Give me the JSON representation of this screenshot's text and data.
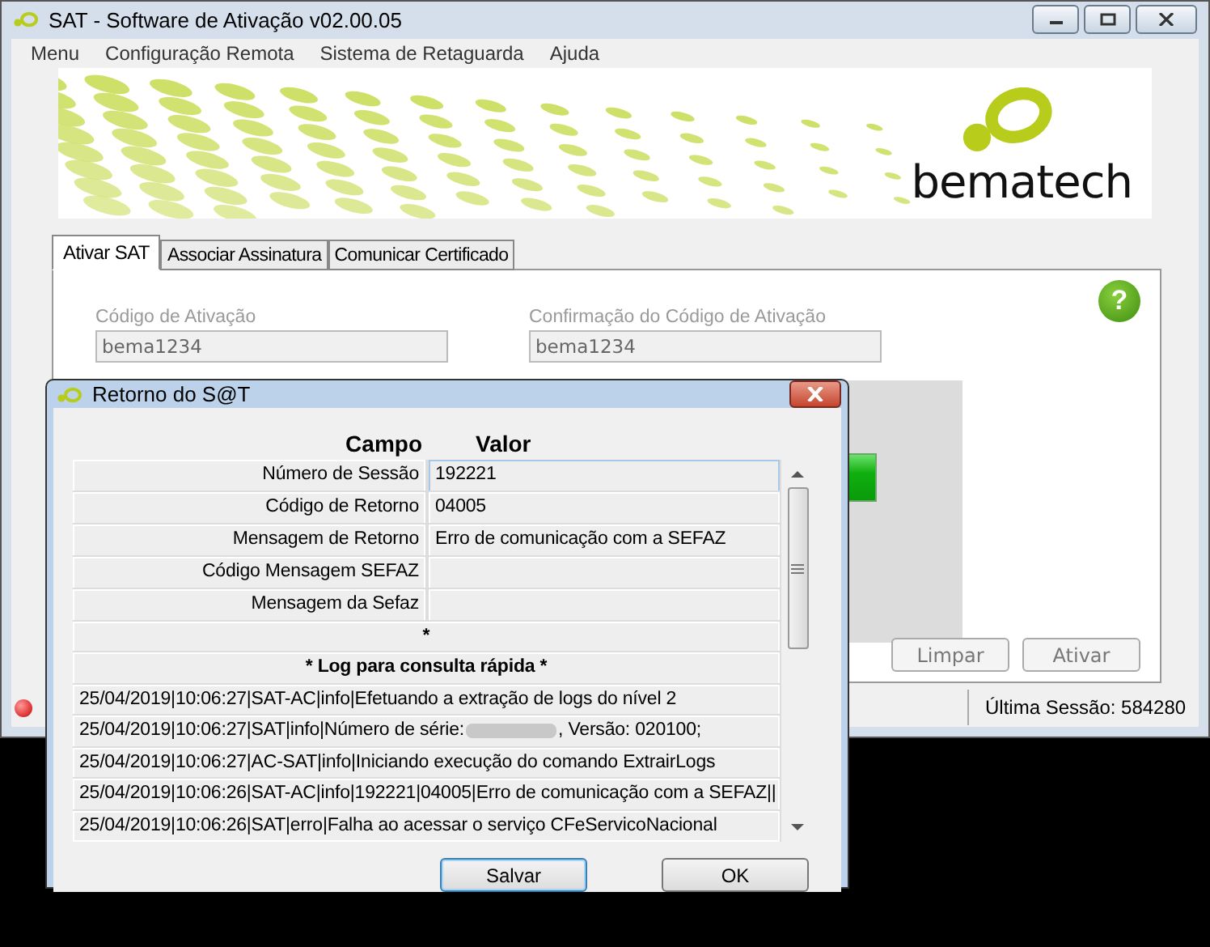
{
  "window": {
    "title": "SAT - Software de Ativação v02.00.05"
  },
  "menu": [
    "Menu",
    "Configuração Remota",
    "Sistema de Retaguarda",
    "Ajuda"
  ],
  "banner": {
    "brand": "bematech"
  },
  "tabs": [
    {
      "label": "Ativar SAT",
      "selected": true
    },
    {
      "label": "Associar Assinatura",
      "selected": false
    },
    {
      "label": "Comunicar Certificado",
      "selected": false
    }
  ],
  "help": "?",
  "fields": [
    {
      "label": "Código de Ativação",
      "value": "bema1234",
      "disabled": true
    },
    {
      "label": "Confirmação do Código de Ativação",
      "value": "bema1234",
      "disabled": true
    }
  ],
  "buttons": [
    {
      "label": "Limpar",
      "disabled": true
    },
    {
      "label": "Ativar",
      "disabled": true
    }
  ],
  "status_bar": {
    "connected": false,
    "last_session": "Última Sessão: 584280"
  },
  "dialog": {
    "title": "Retorno do S@T",
    "columns": [
      "Campo",
      "Valor"
    ],
    "rows": [
      {
        "field": "Número de Sessão",
        "value": "192221",
        "selected": true
      },
      {
        "field": "Código de Retorno",
        "value": "04005",
        "selected": false
      },
      {
        "field": "Mensagem de Retorno",
        "value": "Erro de comunicação com a SEFAZ",
        "selected": false
      },
      {
        "field": "Código Mensagem SEFAZ",
        "value": "",
        "selected": false
      },
      {
        "field": "Mensagem da Sefaz",
        "value": "",
        "selected": false
      }
    ],
    "separator": "*",
    "log_title": "* Log para consulta rápida *",
    "log": [
      {
        "kind": "plain",
        "text": "25/04/2019|10:06:27|SAT-AC|info|Efetuando a extração de logs do nível 2"
      },
      {
        "kind": "redacted",
        "text": "25/04/2019|10:06:27|SAT|info|Número de série:",
        "text_after": ", Versão: 020100;"
      },
      {
        "kind": "plain",
        "text": "25/04/2019|10:06:27|AC-SAT|info|Iniciando execução do comando ExtrairLogs"
      },
      {
        "kind": "plain",
        "text": "25/04/2019|10:06:26|SAT-AC|info|192221|04005|Erro de comunicação com a SEFAZ||"
      },
      {
        "kind": "plain",
        "text": "25/04/2019|10:06:26|SAT|erro|Falha ao acessar o serviço CFeServicoNacional"
      }
    ],
    "buttons": [
      {
        "label": "Salvar",
        "default": true
      },
      {
        "label": "OK",
        "default": false
      }
    ]
  }
}
